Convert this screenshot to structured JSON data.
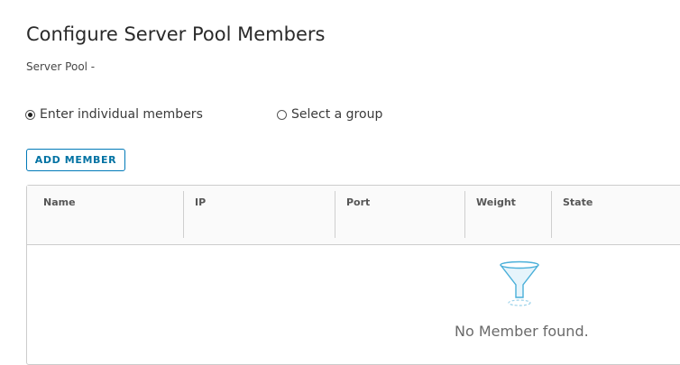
{
  "page": {
    "title": "Configure Server Pool Members",
    "subtitle": "Server Pool -"
  },
  "member_mode": {
    "options": [
      {
        "label": "Enter individual members",
        "checked": true
      },
      {
        "label": "Select a group",
        "checked": false
      }
    ]
  },
  "toolbar": {
    "add_member_label": "ADD MEMBER"
  },
  "table": {
    "columns": [
      "Name",
      "IP",
      "Port",
      "Weight",
      "State"
    ],
    "rows": [],
    "empty_text": "No Member found.",
    "empty_icon": "filter-funnel-icon"
  },
  "colors": {
    "accent": "#0079b8",
    "border": "#cccccc"
  }
}
